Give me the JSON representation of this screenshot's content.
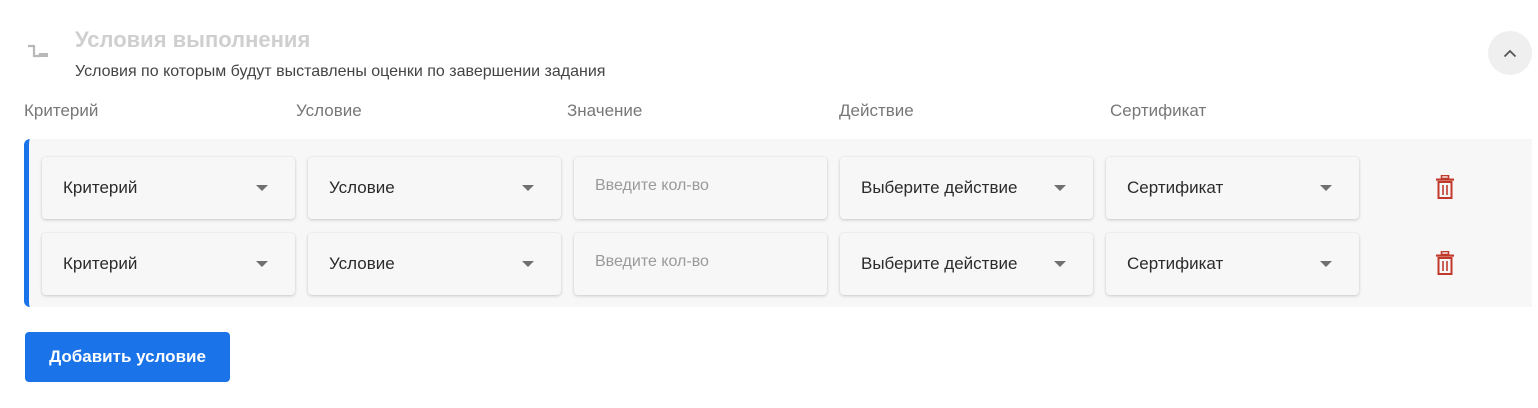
{
  "section": {
    "icon": "route-step-icon",
    "title": "Условия выполнения",
    "subtitle": "Условия по которым будут выставлены оценки по завершении задания",
    "collapse_icon": "chevron-up-icon"
  },
  "columns": [
    "Критерий",
    "Условие",
    "Значение",
    "Действие",
    "Сертификат"
  ],
  "rows": [
    {
      "criterion": "Критерий",
      "condition": "Условие",
      "value": "",
      "value_placeholder": "Введите кол-во",
      "action": "Выберите действие",
      "certificate": "Сертификат",
      "delete_icon": "trash-icon"
    },
    {
      "criterion": "Критерий",
      "condition": "Условие",
      "value": "",
      "value_placeholder": "Введите кол-во",
      "action": "Выберите действие",
      "certificate": "Сертификат",
      "delete_icon": "trash-icon"
    }
  ],
  "add_button": "Добавить условие",
  "colors": {
    "accent": "#1a73e8",
    "delete": "#c0392b",
    "title_muted": "#cfcfcf",
    "panel_bg": "#f7f7f7"
  }
}
